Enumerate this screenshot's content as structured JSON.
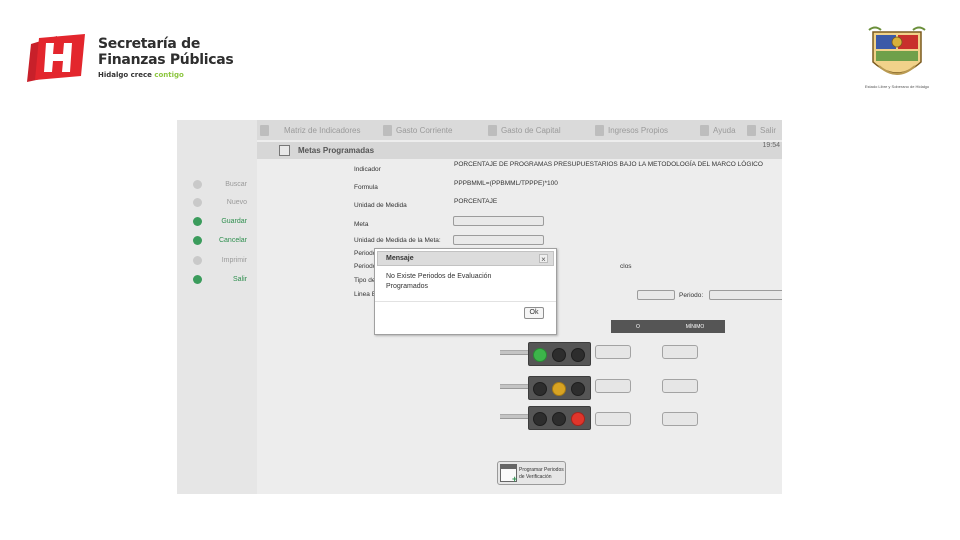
{
  "header": {
    "brand_line1": "Secretaría de",
    "brand_line2": "Finanzas Públicas",
    "tagline_a": "Hidalgo crece ",
    "tagline_b": "contigo",
    "seal_caption": "Estado Libre y Soberano de Hidalgo"
  },
  "colors": {
    "brand_red": "#e3262d",
    "brand_green": "#8cc63f",
    "toolbar": "#dadada",
    "success_green": "#2f8f4f"
  },
  "topnav": [
    {
      "label": "Matriz de Indicadores",
      "icon": "home-icon"
    },
    {
      "label": "Gasto Corriente",
      "icon": "monitor-icon"
    },
    {
      "label": "Gasto de Capital",
      "icon": "building-icon"
    },
    {
      "label": "Ingresos Propios",
      "icon": "money-icon"
    },
    {
      "label": "Ayuda",
      "icon": "help-icon"
    },
    {
      "label": "Salir",
      "icon": "exit-icon"
    }
  ],
  "sidebar": [
    {
      "label": "Buscar",
      "icon": "search-icon",
      "active": false
    },
    {
      "label": "Nuevo",
      "icon": "new-document-icon",
      "active": false
    },
    {
      "label": "Guardar",
      "icon": "save-icon",
      "active": true
    },
    {
      "label": "Cancelar",
      "icon": "cancel-icon",
      "active": true
    },
    {
      "label": "Imprimir",
      "icon": "print-icon",
      "active": false
    },
    {
      "label": "Salir",
      "icon": "exit-icon",
      "active": true
    }
  ],
  "section": {
    "title": "Metas Programadas",
    "clock": "19:54"
  },
  "form": {
    "indicador_label": "Indicador",
    "indicador_value": "PORCENTAJE DE PROGRAMAS PRESUPUESTARIOS BAJO LA METODOLOGÍA DEL MARCO LÓGICO",
    "formula_label": "Formula",
    "formula_value": "PPPBMML=(PPBMML/TPPPE)*100",
    "unidad_label": "Unidad de Medida",
    "unidad_value": "PORCENTAJE",
    "meta_label": "Meta",
    "unidad_meta_label": "Unidad de Medida de la Meta:",
    "periodo_cumplimiento_label": "Periodo de Cumplimiento",
    "periodo_verificacion_label": "Periodo de Verificación:",
    "tipo_medicion_label": "Tipo de Medicion:",
    "linea_base_label": "Linea Base",
    "periodo_label": "Periodo:",
    "partial_text": "clos"
  },
  "semaforo": {
    "col_max_partial": "O",
    "col_min": "MÍNIMO",
    "lights": [
      {
        "active": "green",
        "color": "#3cb54a"
      },
      {
        "active": "yellow",
        "color": "#d8a322"
      },
      {
        "active": "red",
        "color": "#e0352b"
      }
    ]
  },
  "program_button": {
    "line1": "Programar Periodos",
    "line2": "de Verificación"
  },
  "dialog": {
    "title": "Mensaje",
    "close": "×",
    "line1": "No Existe Periodos de Evaluación",
    "line2": "Programados",
    "ok": "Ok"
  }
}
